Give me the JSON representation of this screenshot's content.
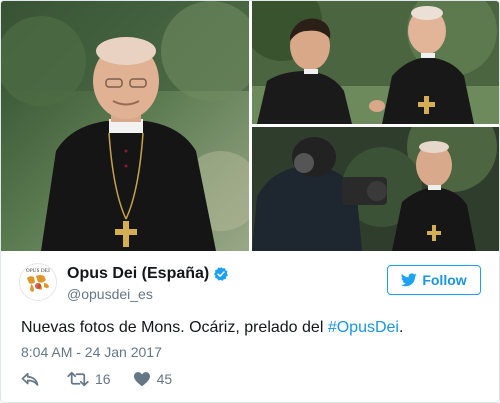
{
  "photos": {
    "main_alt": "",
    "top_right_alt": "",
    "bottom_right_alt": ""
  },
  "account": {
    "avatar_text": "OPUS DEI",
    "name": "Opus Dei (España)",
    "handle": "@opusdei_es",
    "verified_icon": "verified-badge-icon"
  },
  "follow_button": {
    "label": "Follow",
    "icon": "twitter-bird-icon"
  },
  "tweet": {
    "text": "Nuevas fotos de Mons. Ocáriz, prelado del ",
    "hashtag": "#OpusDei",
    "text_end": ".",
    "timestamp": "8:04 AM - 24 Jan 2017"
  },
  "actions": {
    "reply_icon": "reply-icon",
    "retweet_icon": "retweet-icon",
    "retweets": "16",
    "like_icon": "heart-icon",
    "likes": "45"
  },
  "colors": {
    "accent": "#1da1f2",
    "link": "#1b95e0",
    "muted": "#657786"
  }
}
